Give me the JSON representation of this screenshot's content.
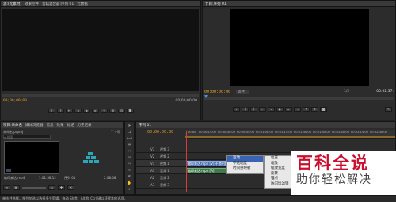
{
  "source_panel": {
    "tabs": [
      "源:(无素材)",
      "效果控件",
      "音轨混合器:序列 01",
      "元数据"
    ],
    "timecode_left": "00;00;00;00",
    "timecode_right": "00;00;00;00"
  },
  "program_panel": {
    "tab": "节目:序列 01",
    "timecode": "00:00:00:00",
    "fit_label": "适合",
    "page": "1/2",
    "duration": "00:02:37:"
  },
  "project_panel": {
    "tabs": [
      "项目:未命名",
      "媒体浏览器",
      "信息",
      "效果",
      "标记",
      "历史记录"
    ],
    "item_count": "7 个项",
    "project_file": "未命名.prproj",
    "search_placeholder": "搜索",
    "clip_name": "缩印来达.mp4",
    "clip_duration": "1:01:58:12",
    "seq_name": "序列 01",
    "seq_duration": "2:08:08"
  },
  "timeline": {
    "tab": "序列 01",
    "timecode": "00:00:00:00",
    "ruler": [
      "00:00",
      "00:00:15:00",
      "00:00:30:00",
      "00:00:45:00",
      "00:01:00:00",
      "00:01:15:00",
      "00:01:30:00",
      "00:01:45:00",
      "00:02:00:00",
      "00:02:15:00",
      "00:02:30:00"
    ],
    "tracks": [
      {
        "id": "v3",
        "label": "V3",
        "name": "视频 3"
      },
      {
        "id": "v2",
        "label": "V2",
        "name": "视频 2"
      },
      {
        "id": "v1",
        "label": "V1",
        "name": "视频 1"
      },
      {
        "id": "a1",
        "label": "A1",
        "name": "音频 1"
      },
      {
        "id": "a2",
        "label": "A2",
        "name": "音频 2"
      },
      {
        "id": "a3",
        "label": "A3",
        "name": "音频 3"
      }
    ],
    "clip_v1": "缩印来达.mp4 [V] 不透明度",
    "clip_a1": "缩印来达.mp4 [A]"
  },
  "context_menu": {
    "items": [
      "运动",
      "不透明度",
      "时间重映射"
    ],
    "highlighted": "运动"
  },
  "submenu": {
    "items": [
      "位置",
      "缩放",
      "缩放宽度",
      "旋转",
      "锚点",
      "防闪烁滤镜"
    ]
  },
  "watermark": {
    "title": "百科全说",
    "subtitle": "助你轻松解决"
  },
  "status_bar": {
    "text": "单击并选择。按住加选以选择多个剪辑。拖动 Shift、Alt 和 Ctrl 键以获得其他选项。"
  },
  "colors": {
    "timecode": "#e8a22c",
    "video_clip": "#4a6fb5",
    "audio_clip": "#3f7a4d",
    "highlight": "#3a63b3",
    "playhead": "#d83a3a"
  }
}
